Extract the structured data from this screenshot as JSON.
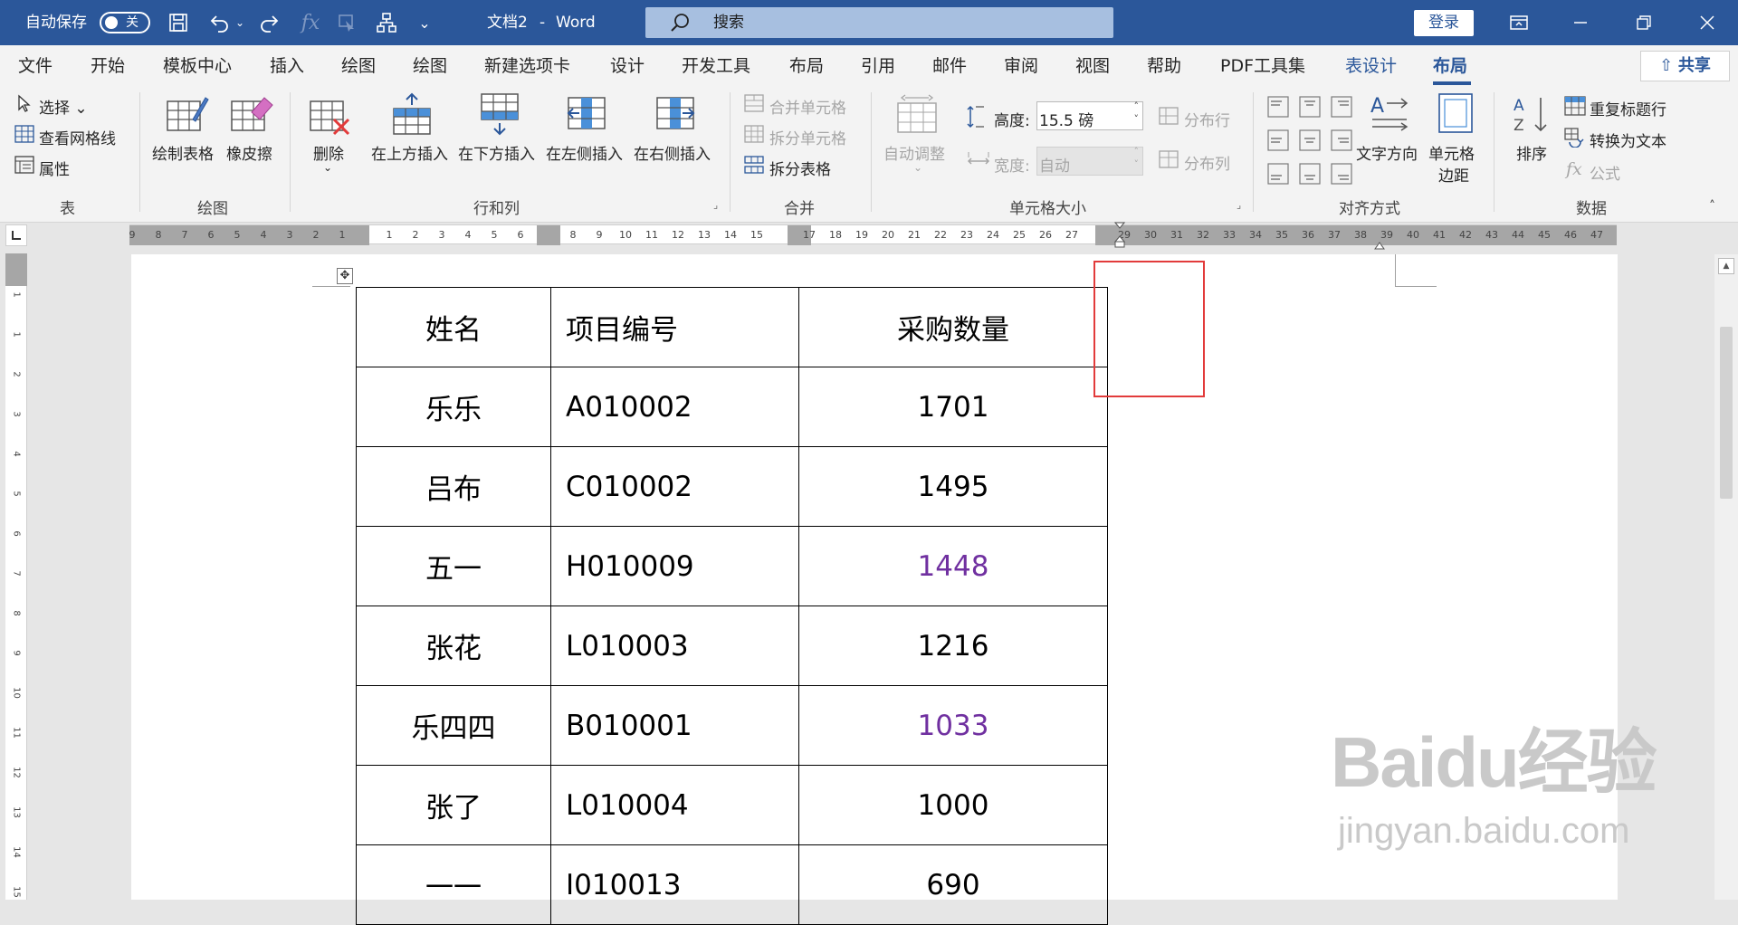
{
  "titlebar": {
    "autosave_label": "自动保存",
    "autosave_state": "关",
    "doc_title": "文档2",
    "separator": "-",
    "app_name": "Word",
    "search_placeholder": "搜索",
    "login_label": "登录"
  },
  "menu": {
    "items": [
      "文件",
      "开始",
      "模板中心",
      "插入",
      "绘图",
      "绘图",
      "新建选项卡",
      "设计",
      "开发工具",
      "布局",
      "引用",
      "邮件",
      "审阅",
      "视图",
      "帮助",
      "PDF工具集",
      "表设计",
      "布局"
    ],
    "share_label": "共享"
  },
  "ribbon": {
    "table_group": {
      "label": "表",
      "select": "选择",
      "gridlines": "查看网格线",
      "properties": "属性"
    },
    "draw_group": {
      "label": "绘图",
      "draw_table": "绘制表格",
      "eraser": "橡皮擦"
    },
    "rows_cols_group": {
      "label": "行和列",
      "delete": "删除",
      "insert_above": "在上方插入",
      "insert_below": "在下方插入",
      "insert_left": "在左侧插入",
      "insert_right": "在右侧插入"
    },
    "merge_group": {
      "label": "合并",
      "merge_cells": "合并单元格",
      "split_cells": "拆分单元格",
      "split_table": "拆分表格"
    },
    "cell_size_group": {
      "label": "单元格大小",
      "autofit": "自动调整",
      "height_label": "高度:",
      "height_value": "15.5 磅",
      "width_label": "宽度:",
      "width_value": "自动",
      "distribute_rows": "分布行",
      "distribute_cols": "分布列"
    },
    "alignment_group": {
      "label": "对齐方式",
      "text_direction": "文字方向",
      "cell_margins_1": "单元格",
      "cell_margins_2": "边距"
    },
    "data_group": {
      "label": "数据",
      "sort": "排序",
      "repeat_header": "重复标题行",
      "convert_to_text": "转换为文本",
      "formula": "公式"
    }
  },
  "ruler": {
    "h_left": [
      "9",
      "8",
      "7",
      "6",
      "5",
      "4",
      "3",
      "2",
      "1"
    ],
    "h_right": [
      "1",
      "2",
      "3",
      "4",
      "5",
      "6",
      "8",
      "9",
      "10",
      "11",
      "12",
      "13",
      "14",
      "15",
      "17",
      "18",
      "19",
      "20",
      "21",
      "22",
      "23",
      "24",
      "25",
      "26",
      "27",
      "29",
      "30",
      "31",
      "32",
      "33",
      "34",
      "35",
      "36",
      "37",
      "38",
      "39",
      "40",
      "41",
      "42",
      "43",
      "44",
      "45",
      "46",
      "47"
    ],
    "v": [
      "1",
      "1",
      "2",
      "3",
      "4",
      "5",
      "6",
      "7",
      "8",
      "9",
      "10",
      "11",
      "12",
      "13",
      "14",
      "15"
    ]
  },
  "table": {
    "headers": [
      "姓名",
      "项目编号",
      "采购数量"
    ],
    "rows": [
      {
        "name": "乐乐",
        "code": "A010002",
        "qty": "1701",
        "highlight": false
      },
      {
        "name": "吕布",
        "code": "C010002",
        "qty": "1495",
        "highlight": false
      },
      {
        "name": "五一",
        "code": "H010009",
        "qty": "1448",
        "highlight": true
      },
      {
        "name": "张花",
        "code": "L010003",
        "qty": "1216",
        "highlight": false
      },
      {
        "name": "乐四四",
        "code": "B010001",
        "qty": "1033",
        "highlight": true
      },
      {
        "name": "张了",
        "code": "L010004",
        "qty": "1000",
        "highlight": false
      },
      {
        "name": "一一",
        "code": "I010013",
        "qty": "690",
        "highlight": false
      }
    ],
    "highlight_color": "#7030a0"
  },
  "watermark": {
    "line1": "Baidu经验",
    "line2": "jingyan.baidu.com"
  },
  "colors": {
    "accent": "#2b579a",
    "callout": "#e23b3b"
  }
}
